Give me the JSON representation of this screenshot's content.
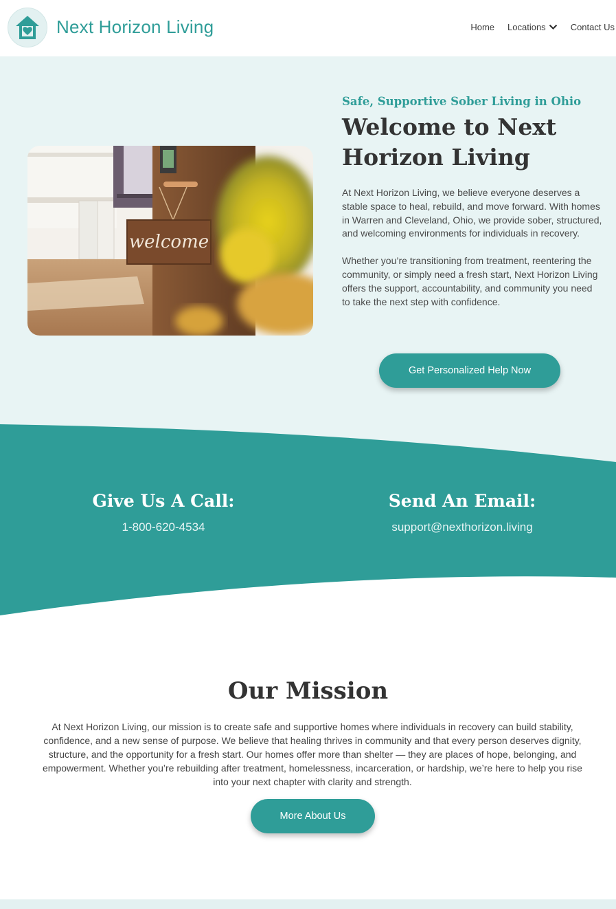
{
  "colors": {
    "brand": "#2f9d98",
    "hero_bg": "#e8f4f4",
    "band": "#2f9d98",
    "heading": "#333333"
  },
  "header": {
    "brand": "Next Horizon Living",
    "logo_icon": "house-heart-icon",
    "nav": {
      "home": "Home",
      "locations": "Locations",
      "contact": "Contact Us"
    }
  },
  "hero": {
    "tagline": "Safe, Supportive Sober Living in Ohio",
    "title_line1": "Welcome to Next",
    "title_line2": "Horizon Living",
    "paragraph1": "At Next Horizon Living, we believe everyone deserves a stable space to heal, rebuild, and move forward. With homes in Warren and Cleveland, Ohio, we provide sober, structured, and welcoming environments for individuals in recovery.",
    "paragraph2": "Whether you’re transitioning from treatment, reentering the community, or simply need a fresh start, Next Horizon Living offers the support, accountability, and community you need to take the next step with confidence.",
    "cta": "Get Personalized Help Now",
    "image_sign": "welcome"
  },
  "contact": {
    "call_heading": "Give Us A Call:",
    "phone": "1-800-620-4534",
    "email_heading": "Send An Email:",
    "email": "support@nexthorizon.living"
  },
  "mission": {
    "title": "Our Mission",
    "body": "At Next Horizon Living, our mission is to create safe and supportive homes where individuals in recovery can build stability, confidence, and a new sense of purpose. We believe that healing thrives in community and that every person deserves dignity, structure, and the opportunity for a fresh start. Our homes offer more than shelter — they are places of hope, belonging, and empowerment. Whether you’re rebuilding after treatment, homelessness, incarceration, or hardship, we’re here to help you rise into your next chapter with clarity and strength.",
    "button": "More About Us"
  }
}
